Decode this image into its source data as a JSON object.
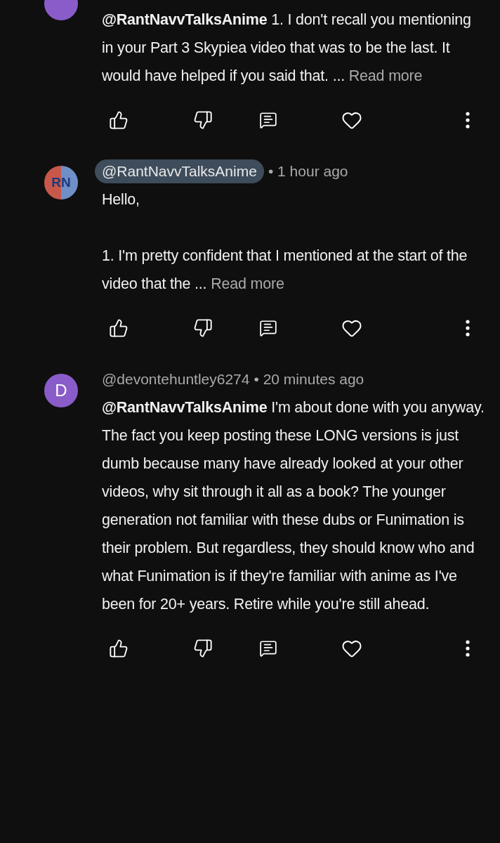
{
  "comments": [
    {
      "avatar": {
        "kind": "letter",
        "color": "#8a5cc9"
      },
      "body": "**@RantNavvTalksAnime** 1. I don't recall you mentioning in your Part 3 Skypiea video that was to be the last. It would have helped if you said that. ...",
      "read_more": "Read more"
    },
    {
      "avatar": {
        "kind": "logo",
        "text": "RN"
      },
      "author": "@RantNavvTalksAnime",
      "author_highlighted": true,
      "time": "• 1 hour ago",
      "body": "Hello,\n\n1. I'm pretty confident that I mentioned at the start of the video that the ...",
      "read_more": "Read more"
    },
    {
      "avatar": {
        "kind": "letter",
        "text": "D",
        "color": "#8a5cc9"
      },
      "author": "@devontehuntley6274",
      "author_highlighted": false,
      "time": "• 20 minutes ago",
      "body": "**@RantNavvTalksAnime** I'm about done with you anyway. The fact you keep posting these LONG versions is just dumb because many have already looked at your other videos, why sit through it all as a book? The younger generation not familiar with these dubs or Funimation is their problem. But regardless, they should know who and what Funimation is if they're familiar with anime as I've been for 20+ years. Retire while you're still ahead."
    }
  ]
}
